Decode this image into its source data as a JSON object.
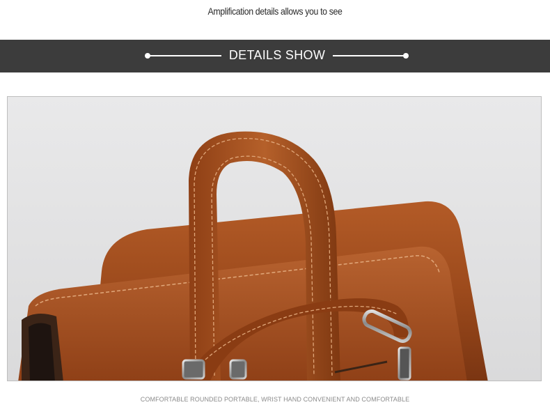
{
  "header": {
    "caption": "Amplification details allows you to see"
  },
  "banner": {
    "title": "DETAILS SHOW"
  },
  "photo": {
    "subject": "brown-leather-bag-handle-detail",
    "colors": {
      "leather": "#a24e1f",
      "leather_dark": "#6e2f0e",
      "background": "#e4e4e5"
    }
  },
  "footer": {
    "caption": "COMFORTABLE ROUNDED PORTABLE, WRIST HAND CONVENIENT AND COMFORTABLE"
  }
}
